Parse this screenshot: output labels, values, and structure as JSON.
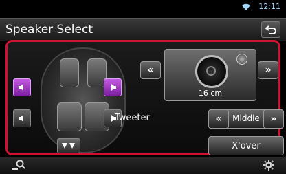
{
  "status": {
    "time": "12:11"
  },
  "header": {
    "title": "Speaker Select"
  },
  "speaker": {
    "size_label": "16 cm"
  },
  "tweeter": {
    "label": "Tweeter",
    "value": "Middle"
  },
  "xover": {
    "label": "X'over"
  },
  "arrows": {
    "left": "«",
    "right": "»"
  },
  "colors": {
    "accent": "#d01030",
    "active_speaker": "#b04ad8",
    "time": "#9fd7ff"
  },
  "icons": [
    "wifi-icon",
    "back-icon",
    "speaker-icon",
    "search-icon",
    "gear-icon"
  ]
}
